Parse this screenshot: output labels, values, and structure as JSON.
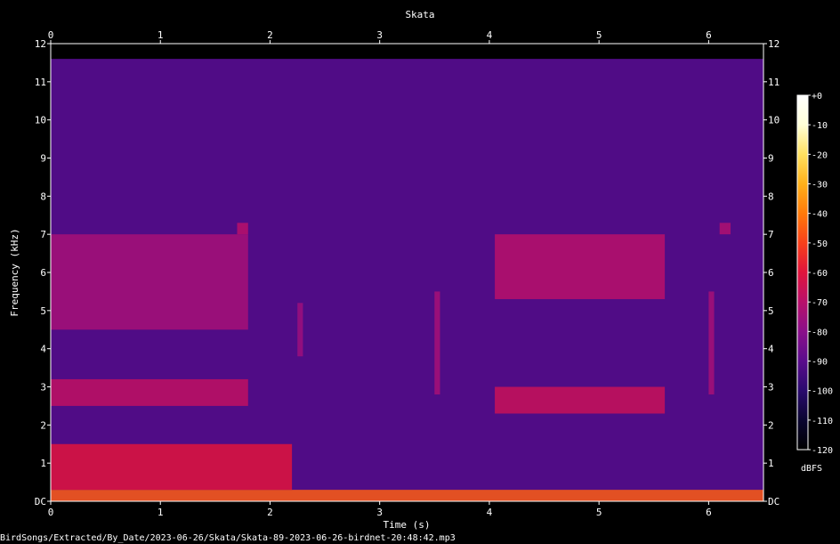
{
  "chart_data": {
    "type": "heatmap",
    "title": "Skata",
    "xlabel": "Time (s)",
    "ylabel": "Frequency (kHz)",
    "xlim": [
      0,
      6.5
    ],
    "ylim": [
      0,
      12
    ],
    "x_ticks": [
      0,
      1,
      2,
      3,
      4,
      5,
      6
    ],
    "y_ticks": [
      {
        "value": 0,
        "label": "DC"
      },
      {
        "value": 1,
        "label": "1"
      },
      {
        "value": 2,
        "label": "2"
      },
      {
        "value": 3,
        "label": "3"
      },
      {
        "value": 4,
        "label": "4"
      },
      {
        "value": 5,
        "label": "5"
      },
      {
        "value": 6,
        "label": "6"
      },
      {
        "value": 7,
        "label": "7"
      },
      {
        "value": 8,
        "label": "8"
      },
      {
        "value": 9,
        "label": "9"
      },
      {
        "value": 10,
        "label": "10"
      },
      {
        "value": 11,
        "label": "11"
      },
      {
        "value": 12,
        "label": "12"
      }
    ],
    "colorbar": {
      "unit": "dBFS",
      "range": [
        -120,
        0
      ],
      "ticks": [
        {
          "value": 0,
          "label": "+0"
        },
        {
          "value": -10,
          "label": "-10"
        },
        {
          "value": -20,
          "label": "-20"
        },
        {
          "value": -30,
          "label": "-30"
        },
        {
          "value": -40,
          "label": "-40"
        },
        {
          "value": -50,
          "label": "-50"
        },
        {
          "value": -60,
          "label": "-60"
        },
        {
          "value": -70,
          "label": "-70"
        },
        {
          "value": -80,
          "label": "-80"
        },
        {
          "value": -90,
          "label": "-90"
        },
        {
          "value": -100,
          "label": "-100"
        },
        {
          "value": -110,
          "label": "-110"
        },
        {
          "value": -120,
          "label": "-120"
        }
      ],
      "colors": [
        "#000000",
        "#0a0530",
        "#2a0a6e",
        "#5a0c8c",
        "#8a0f8a",
        "#b8106a",
        "#e0143c",
        "#f8401a",
        "#ff7a0a",
        "#ffb01a",
        "#ffe060",
        "#ffffd8",
        "#ffffff"
      ]
    },
    "noise_floor_dbfs": -92,
    "energy_regions": [
      {
        "t": [
          0,
          6.5
        ],
        "f": [
          0,
          0.3
        ],
        "dbfs": -45
      },
      {
        "t": [
          0,
          2.2
        ],
        "f": [
          0.3,
          1.5
        ],
        "dbfs": -60
      },
      {
        "t": [
          0,
          1.8
        ],
        "f": [
          2.5,
          3.2
        ],
        "dbfs": -68
      },
      {
        "t": [
          0,
          1.8
        ],
        "f": [
          4.5,
          7
        ],
        "dbfs": -74
      },
      {
        "t": [
          4.05,
          5.6
        ],
        "f": [
          2.3,
          3
        ],
        "dbfs": -66
      },
      {
        "t": [
          4.05,
          5.6
        ],
        "f": [
          5.3,
          7
        ],
        "dbfs": -70
      },
      {
        "t": [
          1.7,
          1.8
        ],
        "f": [
          7,
          7.3
        ],
        "dbfs": -70
      },
      {
        "t": [
          6.1,
          6.2
        ],
        "f": [
          7,
          7.3
        ],
        "dbfs": -72
      },
      {
        "t": [
          3.5,
          3.55
        ],
        "f": [
          2.8,
          5.5
        ],
        "dbfs": -74
      },
      {
        "t": [
          6.0,
          6.05
        ],
        "f": [
          2.8,
          5.5
        ],
        "dbfs": -74
      },
      {
        "t": [
          2.25,
          2.3
        ],
        "f": [
          3.8,
          5.2
        ],
        "dbfs": -76
      }
    ]
  },
  "footer": {
    "file_path": "BirdSongs/Extracted/By_Date/2023-06-26/Skata/Skata-89-2023-06-26-birdnet-20:48:42.mp3"
  }
}
